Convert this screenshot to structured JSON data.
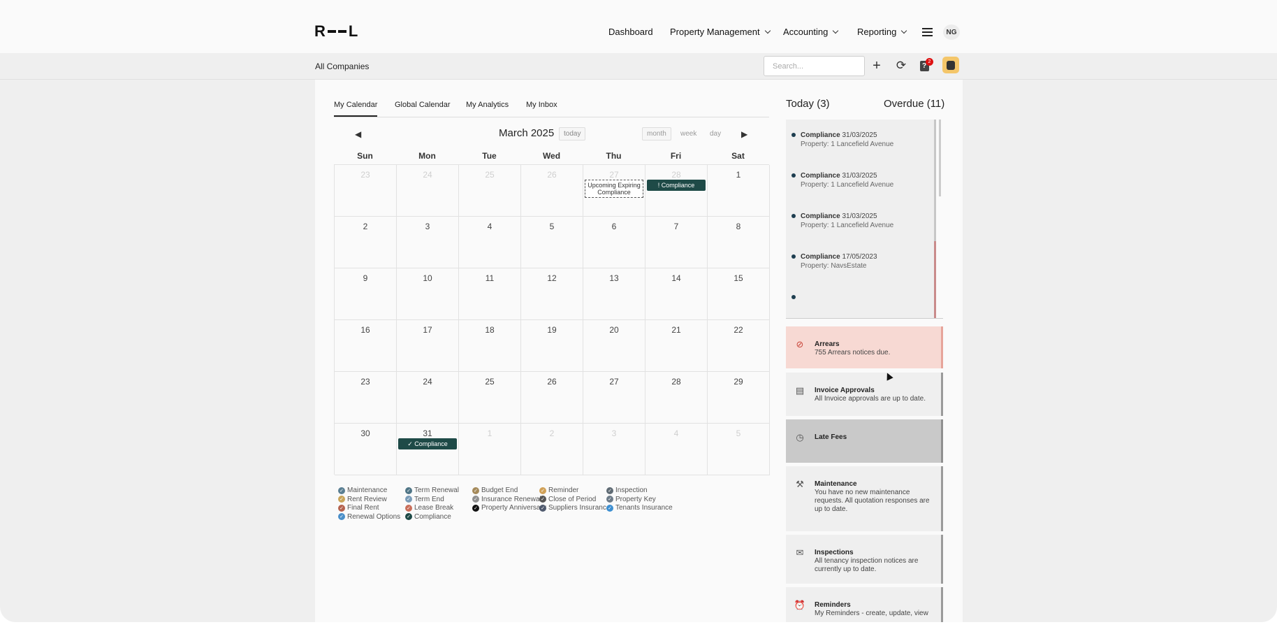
{
  "header": {
    "logo": "R - - L",
    "nav": [
      {
        "label": "Dashboard",
        "dropdown": false
      },
      {
        "label": "Property Management",
        "dropdown": true
      },
      {
        "label": "Accounting",
        "dropdown": true
      },
      {
        "label": "Reporting",
        "dropdown": true
      }
    ],
    "avatar_initials": "NG"
  },
  "subbar": {
    "company": "All Companies",
    "search_placeholder": "Search...",
    "notification_count": "2"
  },
  "calendar_tabs": [
    "My Calendar",
    "Global Calendar",
    "My Analytics",
    "My Inbox"
  ],
  "calendar": {
    "title": "March 2025",
    "today_label": "today",
    "views": [
      "month",
      "week",
      "day"
    ],
    "weekdays": [
      "Sun",
      "Mon",
      "Tue",
      "Wed",
      "Thu",
      "Fri",
      "Sat"
    ],
    "weeks": [
      [
        {
          "d": "23",
          "o": true
        },
        {
          "d": "24",
          "o": true
        },
        {
          "d": "25",
          "o": true
        },
        {
          "d": "26",
          "o": true
        },
        {
          "d": "27",
          "o": true
        },
        {
          "d": "28",
          "o": true
        },
        {
          "d": "1",
          "o": false
        }
      ],
      [
        {
          "d": "2",
          "o": false
        },
        {
          "d": "3",
          "o": false
        },
        {
          "d": "4",
          "o": false
        },
        {
          "d": "5",
          "o": false
        },
        {
          "d": "6",
          "o": false
        },
        {
          "d": "7",
          "o": false
        },
        {
          "d": "8",
          "o": false
        }
      ],
      [
        {
          "d": "9",
          "o": false
        },
        {
          "d": "10",
          "o": false
        },
        {
          "d": "11",
          "o": false
        },
        {
          "d": "12",
          "o": false
        },
        {
          "d": "13",
          "o": false
        },
        {
          "d": "14",
          "o": false
        },
        {
          "d": "15",
          "o": false
        }
      ],
      [
        {
          "d": "16",
          "o": false
        },
        {
          "d": "17",
          "o": false
        },
        {
          "d": "18",
          "o": false
        },
        {
          "d": "19",
          "o": false
        },
        {
          "d": "20",
          "o": false
        },
        {
          "d": "21",
          "o": false
        },
        {
          "d": "22",
          "o": false
        }
      ],
      [
        {
          "d": "23",
          "o": false
        },
        {
          "d": "24",
          "o": false
        },
        {
          "d": "25",
          "o": false
        },
        {
          "d": "26",
          "o": false
        },
        {
          "d": "27",
          "o": false
        },
        {
          "d": "28",
          "o": false
        },
        {
          "d": "29",
          "o": false
        }
      ],
      [
        {
          "d": "30",
          "o": false
        },
        {
          "d": "31",
          "o": false
        },
        {
          "d": "1",
          "o": true
        },
        {
          "d": "2",
          "o": true
        },
        {
          "d": "3",
          "o": true
        },
        {
          "d": "4",
          "o": true
        },
        {
          "d": "5",
          "o": true
        }
      ]
    ],
    "events": [
      {
        "week": 0,
        "day": 4,
        "label": "Upcoming Expiring Compliance",
        "style": "dashed"
      },
      {
        "week": 0,
        "day": 5,
        "label": "! Compliance",
        "style": "solid"
      },
      {
        "week": 5,
        "day": 1,
        "label": "✓ Compliance",
        "style": "solid"
      }
    ]
  },
  "legend": [
    {
      "label": "Maintenance",
      "color": "#5a7f93"
    },
    {
      "label": "Rent Review",
      "color": "#c9a55a"
    },
    {
      "label": "Final Rent",
      "color": "#b5634f"
    },
    {
      "label": "Renewal Options",
      "color": "#4a8fc9"
    },
    {
      "label": "Term Renewal",
      "color": "#4f7586"
    },
    {
      "label": "Term End",
      "color": "#7a9cb8"
    },
    {
      "label": "Lease Break",
      "color": "#c96e5a"
    },
    {
      "label": "Compliance",
      "color": "#1e4a47"
    },
    {
      "label": "Budget End",
      "color": "#a58a5a"
    },
    {
      "label": "Insurance Renewal",
      "color": "#909090"
    },
    {
      "label": "Property Anniversary",
      "color": "#111111"
    },
    {
      "label": "Reminder",
      "color": "#d1a157"
    },
    {
      "label": "Close of Period",
      "color": "#555555"
    },
    {
      "label": "Suppliers Insurance",
      "color": "#4f5a6e"
    },
    {
      "label": "Inspection",
      "color": "#5f6b74"
    },
    {
      "label": "Property Key",
      "color": "#6d7b88"
    },
    {
      "label": "Tenants Insurance",
      "color": "#3d8fd1"
    }
  ],
  "tasks": {
    "today_label": "Today (3)",
    "overdue_label": "Overdue (11)",
    "items": [
      {
        "type": "Compliance",
        "date": "31/03/2025",
        "property": "Property: 1 Lancefield Avenue",
        "overdue": false
      },
      {
        "type": "Compliance",
        "date": "31/03/2025",
        "property": "Property: 1 Lancefield Avenue",
        "overdue": false
      },
      {
        "type": "Compliance",
        "date": "31/03/2025",
        "property": "Property: 1 Lancefield Avenue",
        "overdue": false
      },
      {
        "type": "Compliance",
        "date": "17/05/2023",
        "property": "Property: NavsEstate",
        "overdue": true
      }
    ]
  },
  "summary_cards": [
    {
      "title": "Arrears",
      "text": "755 Arrears notices due.",
      "icon": "alert-circle-icon",
      "bg": "#f7d9d3",
      "border": "#e7a49a"
    },
    {
      "title": "Invoice Approvals",
      "text": "All Invoice approvals are up to date.",
      "icon": "document-icon",
      "bg": "#efefef",
      "border": "#9a9a9a"
    },
    {
      "title": "Late Fees",
      "text": "",
      "icon": "clock-icon",
      "bg": "#c9c9c9",
      "border": "#8f8f8f"
    },
    {
      "title": "Maintenance",
      "text": "You have no new maintenance requests. All quotation responses are up to date.",
      "icon": "tools-icon",
      "bg": "#efefef",
      "border": "#9a9a9a"
    },
    {
      "title": "Inspections",
      "text": "All tenancy inspection notices are currently up to date.",
      "icon": "mail-icon",
      "bg": "#efefef",
      "border": "#9a9a9a"
    },
    {
      "title": "Reminders",
      "text": "My Reminders - create, update, view",
      "icon": "alarm-icon",
      "bg": "#efefef",
      "border": "#9a9a9a"
    }
  ]
}
